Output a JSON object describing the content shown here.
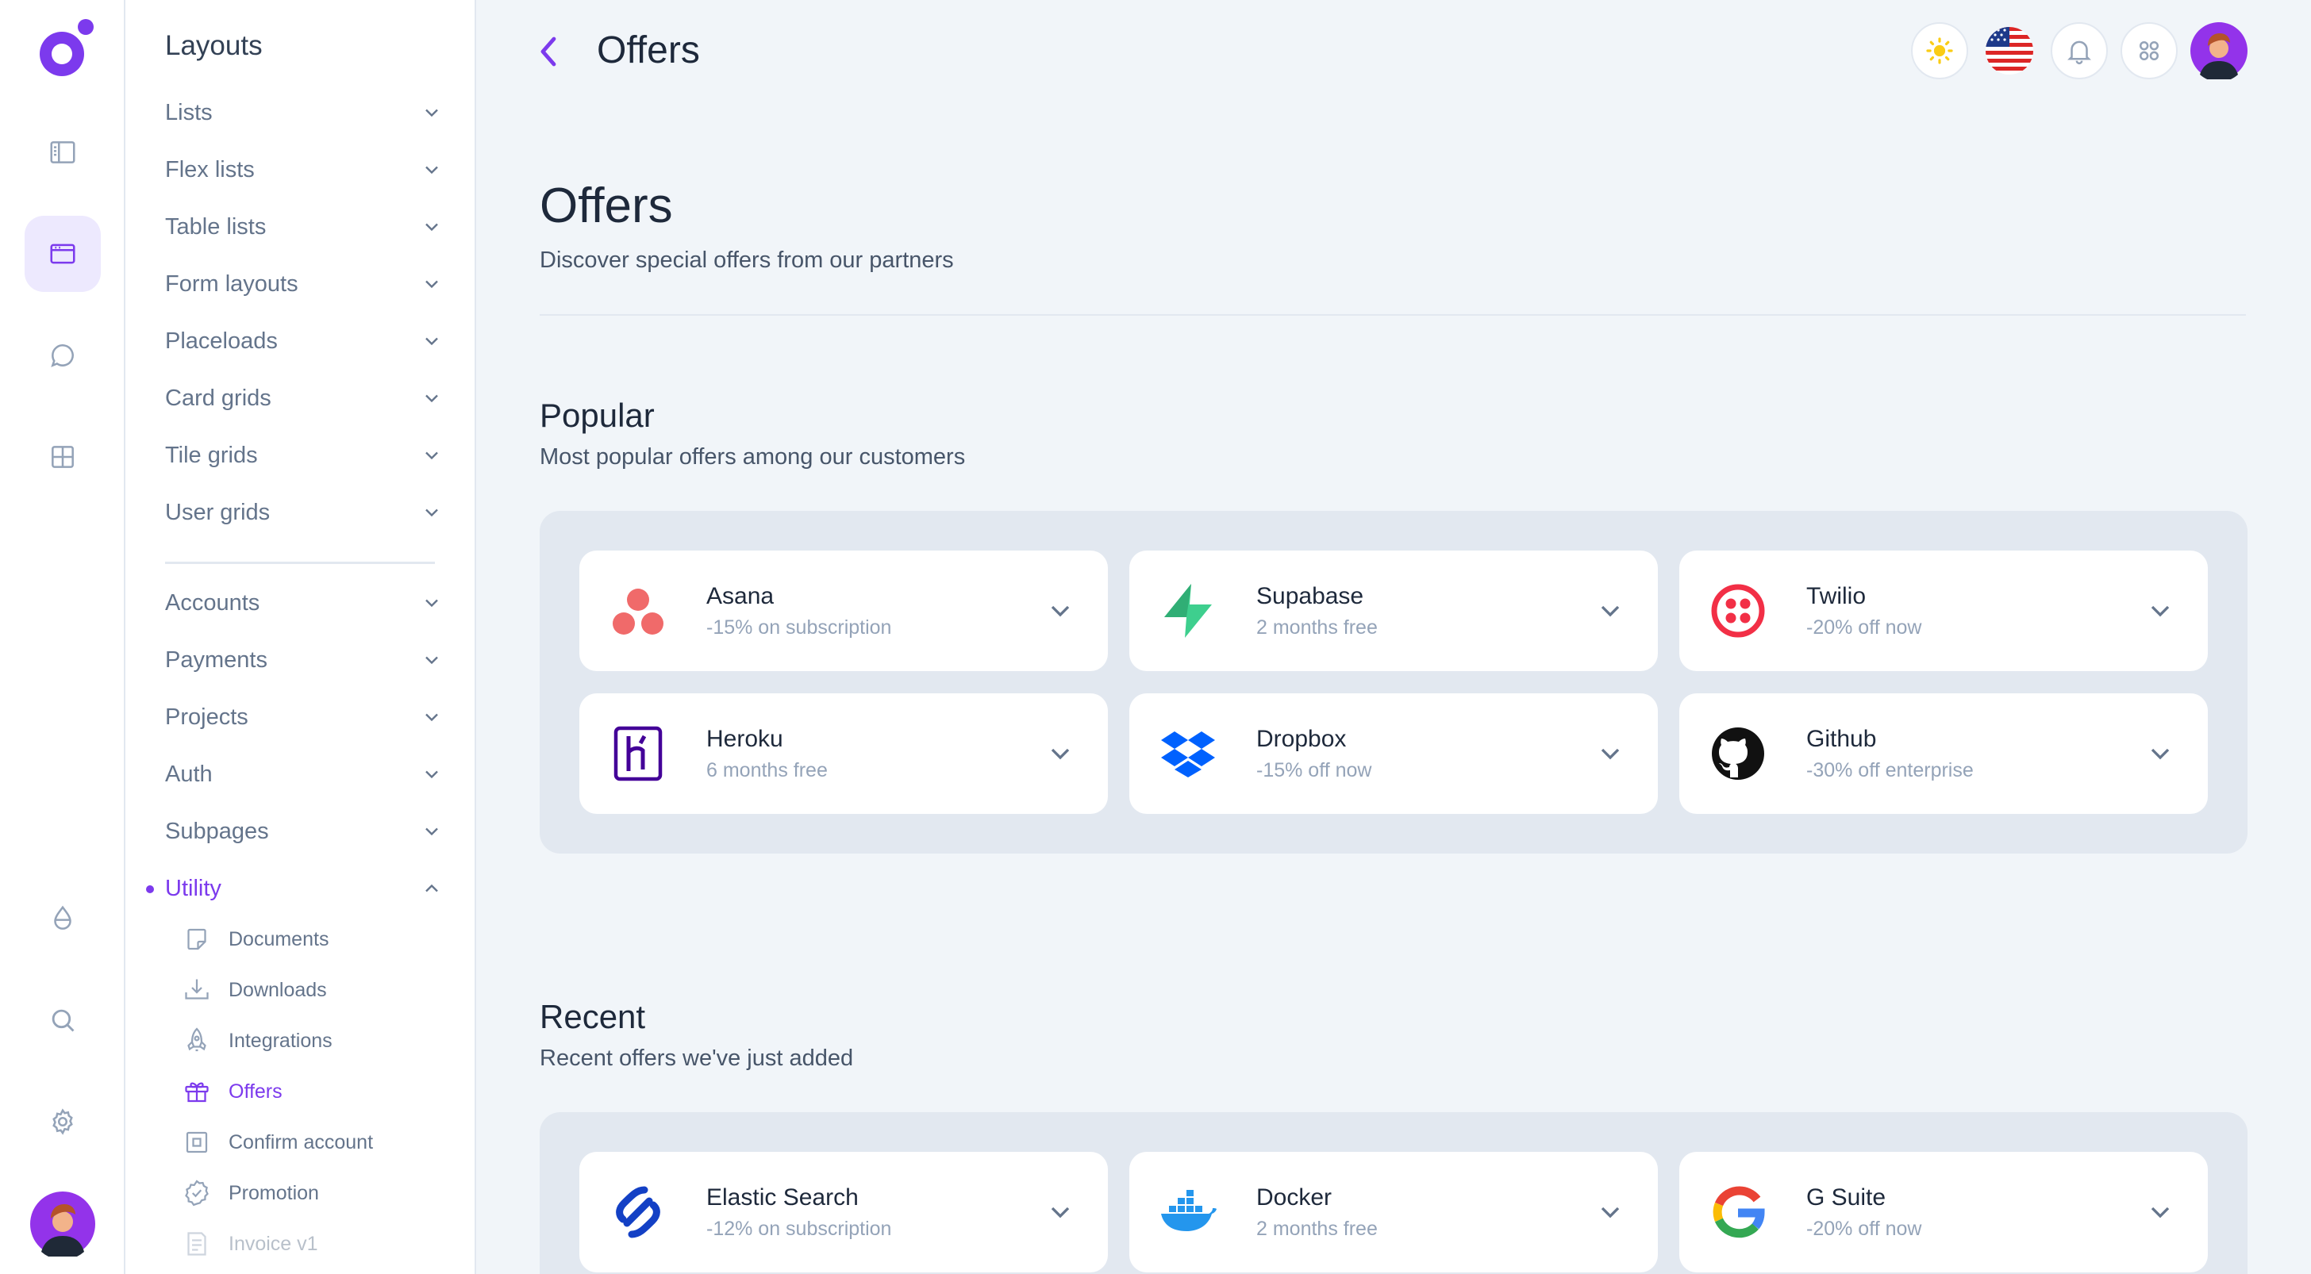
{
  "rail": {
    "items": [
      {
        "name": "sidebar-icon",
        "active": false
      },
      {
        "name": "layout-icon",
        "active": true
      },
      {
        "name": "chat-icon",
        "active": false
      },
      {
        "name": "grid-icon",
        "active": false
      },
      {
        "name": "droplet-icon",
        "active": false
      },
      {
        "name": "search-icon",
        "active": false
      },
      {
        "name": "gear-icon",
        "active": false
      }
    ]
  },
  "sidebar": {
    "title": "Layouts",
    "group1": [
      "Lists",
      "Flex lists",
      "Table lists",
      "Form layouts",
      "Placeloads",
      "Card grids",
      "Tile grids",
      "User grids"
    ],
    "group2": [
      "Accounts",
      "Payments",
      "Projects",
      "Auth",
      "Subpages"
    ],
    "utility_label": "Utility",
    "utility_items": [
      {
        "label": "Documents",
        "icon": "document-icon"
      },
      {
        "label": "Downloads",
        "icon": "download-icon"
      },
      {
        "label": "Integrations",
        "icon": "rocket-icon"
      },
      {
        "label": "Offers",
        "icon": "gift-icon"
      },
      {
        "label": "Confirm account",
        "icon": "confirm-icon"
      },
      {
        "label": "Promotion",
        "icon": "badge-icon"
      },
      {
        "label": "Invoice v1",
        "icon": "invoice-icon"
      }
    ]
  },
  "header": {
    "title": "Offers",
    "tools": [
      "sun-icon",
      "us-flag-icon",
      "bell-icon",
      "apps-icon",
      "user-avatar"
    ]
  },
  "page": {
    "title": "Offers",
    "subtitle": "Discover special offers from our partners"
  },
  "popular": {
    "title": "Popular",
    "subtitle": "Most popular offers among our customers",
    "cards": [
      {
        "name": "Asana",
        "offer": "-15% on subscription",
        "logo": "asana-logo"
      },
      {
        "name": "Supabase",
        "offer": "2 months free",
        "logo": "supabase-logo"
      },
      {
        "name": "Twilio",
        "offer": "-20% off now",
        "logo": "twilio-logo"
      },
      {
        "name": "Heroku",
        "offer": "6 months free",
        "logo": "heroku-logo"
      },
      {
        "name": "Dropbox",
        "offer": "-15% off now",
        "logo": "dropbox-logo"
      },
      {
        "name": "Github",
        "offer": "-30% off enterprise",
        "logo": "github-logo"
      }
    ]
  },
  "recent": {
    "title": "Recent",
    "subtitle": "Recent offers we've just added",
    "cards": [
      {
        "name": "Elastic Search",
        "offer": "-12% on subscription",
        "logo": "elastic-logo"
      },
      {
        "name": "Docker",
        "offer": "2 months free",
        "logo": "docker-logo"
      },
      {
        "name": "G Suite",
        "offer": "-20% off now",
        "logo": "google-logo"
      }
    ]
  },
  "colors": {
    "accent": "#7c3aed",
    "page_bg": "#f1f5f9",
    "panel_bg": "#e2e8f0",
    "card_bg": "#ffffff"
  }
}
